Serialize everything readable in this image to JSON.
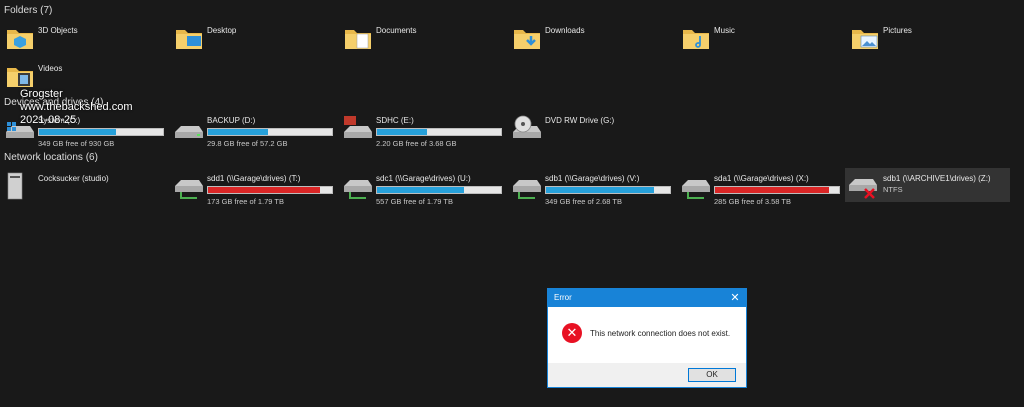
{
  "folders": {
    "header": "Folders (7)",
    "items": [
      {
        "name": "3D Objects",
        "icon": "3d-objects-folder-icon"
      },
      {
        "name": "Desktop",
        "icon": "desktop-folder-icon"
      },
      {
        "name": "Documents",
        "icon": "documents-folder-icon"
      },
      {
        "name": "Downloads",
        "icon": "downloads-folder-icon"
      },
      {
        "name": "Music",
        "icon": "music-folder-icon"
      },
      {
        "name": "Pictures",
        "icon": "pictures-folder-icon"
      },
      {
        "name": "Videos",
        "icon": "videos-folder-icon"
      }
    ]
  },
  "drives": {
    "header": "Devices and drives (4)",
    "items": [
      {
        "name": "System (C:)",
        "free": "349 GB free of 930 GB",
        "used": 0.62
      },
      {
        "name": "BACKUP (D:)",
        "free": "29.8 GB free of 57.2 GB",
        "used": 0.48
      },
      {
        "name": "SDHC (E:)",
        "free": "2.20 GB free of 3.68 GB",
        "used": 0.4
      },
      {
        "name": "DVD RW Drive (G:)",
        "free": "",
        "used": null
      }
    ]
  },
  "network": {
    "header": "Network locations (6)",
    "items": [
      {
        "name": "Cocksucker (studio)",
        "free": "",
        "used": null
      },
      {
        "name": "sdd1 (\\\\Garage\\drives) (T:)",
        "free": "173 GB free of 1.79 TB",
        "used": 0.9
      },
      {
        "name": "sdc1 (\\\\Garage\\drives) (U:)",
        "free": "557 GB free of 1.79 TB",
        "used": 0.7
      },
      {
        "name": "sdb1 (\\\\Garage\\drives) (V:)",
        "free": "349 GB free of 2.68 TB",
        "used": 0.87
      },
      {
        "name": "sda1 (\\\\Garage\\drives) (X:)",
        "free": "285 GB free of 3.58 TB",
        "used": 0.92
      },
      {
        "name": "sdb1 (\\\\ARCHIVE1\\drives) (Z:)",
        "free": "NTFS",
        "used": null
      }
    ]
  },
  "watermark": {
    "line1": "Grogster",
    "line2": "www.thebackshed.com",
    "line3": "2021-08-25"
  },
  "dialog": {
    "title": "Error",
    "message": "This network connection does not exist.",
    "ok_label": "OK",
    "close_glyph": "✕",
    "error_glyph": "✕"
  },
  "colors": {
    "bar_normal": "#26a0da",
    "bar_low": "#da2626",
    "dialog_accent": "#1883d7"
  }
}
